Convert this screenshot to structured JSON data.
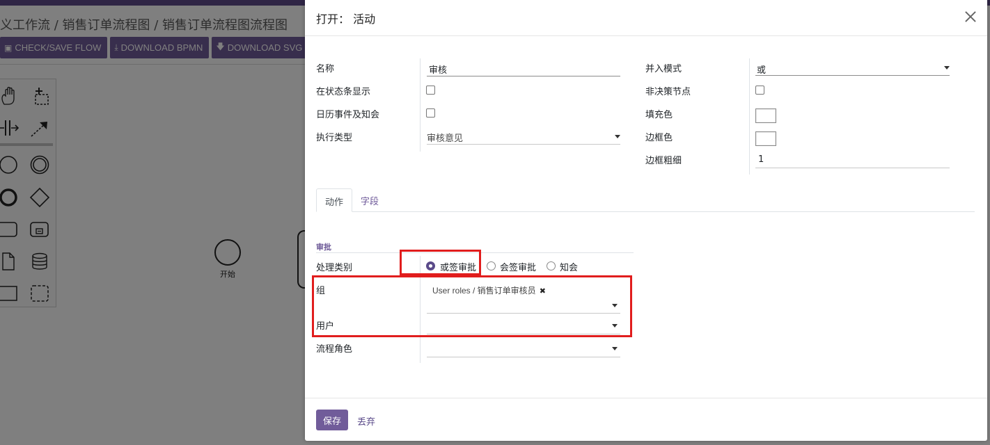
{
  "background": {
    "breadcrumb": "义工作流 / 销售订单流程图 / 销售订单流程图流程图",
    "toolbar": [
      {
        "label": "CHECK/SAVE FLOW",
        "icon": "save-icon"
      },
      {
        "label": "DOWNLOAD BPMN",
        "icon": "download-icon"
      },
      {
        "label": "DOWNLOAD SVG",
        "icon": "arrow-down-icon"
      }
    ],
    "canvas_start_label": "开始"
  },
  "modal": {
    "title": "打开：  活动",
    "left_fields": {
      "name_label": "名称",
      "name_value": "审核",
      "show_statusbar_label": "在状态条显示",
      "calendar_label": "日历事件及知会",
      "exec_type_label": "执行类型",
      "exec_type_value": "审核意见"
    },
    "right_fields": {
      "join_mode_label": "并入模式",
      "join_mode_value": "或",
      "non_decision_label": "非决策节点",
      "fill_color_label": "填充色",
      "border_color_label": "边框色",
      "border_width_label": "边框粗细",
      "border_width_value": "1"
    },
    "tabs": [
      "动作",
      "字段"
    ],
    "section": {
      "title": "审批",
      "process_type_label": "处理类别",
      "radio_options": [
        "或签审批",
        "会签审批",
        "知会"
      ],
      "selected_option": "或签审批",
      "group_label": "组",
      "group_tag": "User roles / 销售订单审核员",
      "user_label": "用户",
      "role_label": "流程角色"
    },
    "buttons": {
      "save": "保存",
      "discard": "丢弃"
    }
  },
  "colors": {
    "primary": "#715c9a",
    "highlight": "#e11d1d"
  }
}
